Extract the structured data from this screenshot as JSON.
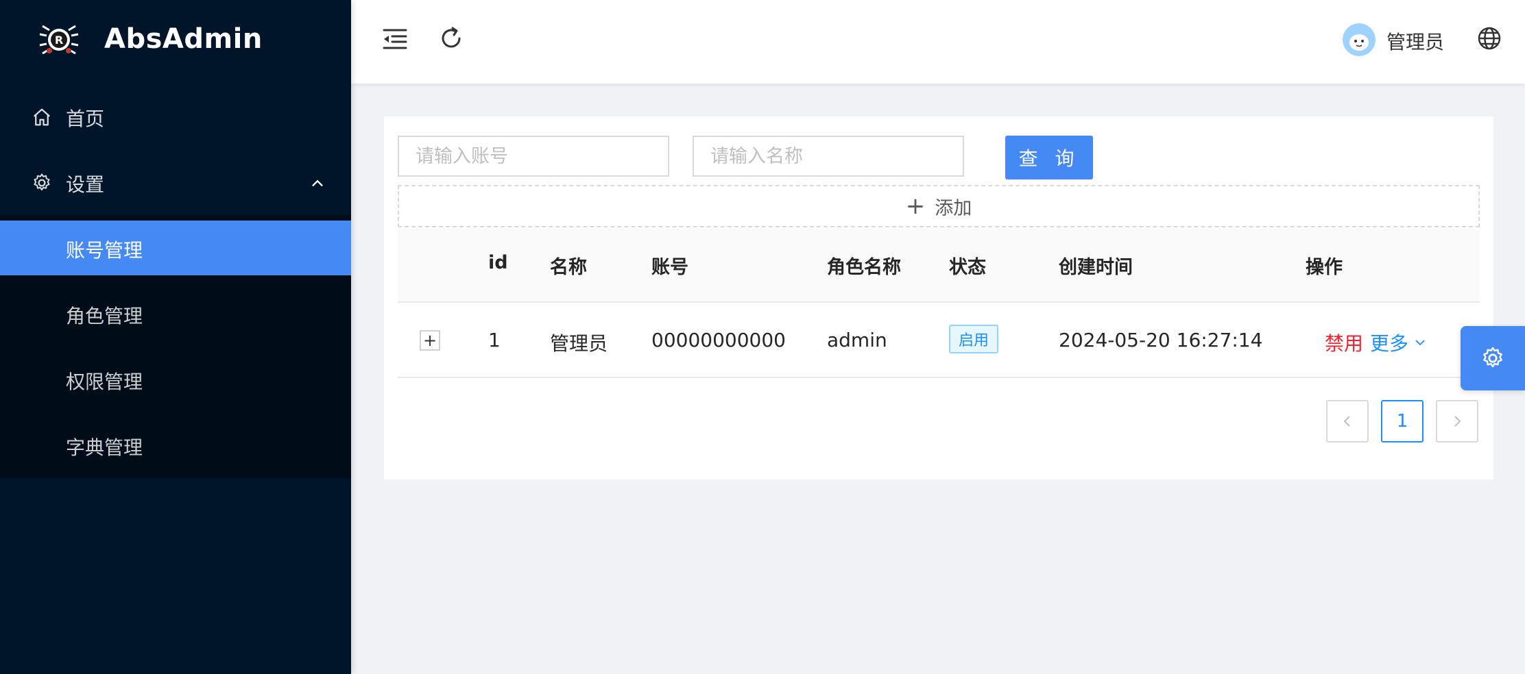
{
  "app": {
    "title": "AbsAdmin"
  },
  "sidebar": {
    "items": [
      {
        "label": "首页",
        "icon": "home-icon"
      },
      {
        "label": "设置",
        "icon": "gear-icon",
        "expanded": true
      }
    ],
    "submenu": [
      {
        "label": "账号管理",
        "active": true
      },
      {
        "label": "角色管理"
      },
      {
        "label": "权限管理"
      },
      {
        "label": "字典管理"
      }
    ]
  },
  "header": {
    "user_name": "管理员",
    "icons": [
      "menu-fold-icon",
      "reload-icon",
      "avatar",
      "globe-icon"
    ]
  },
  "search": {
    "account_placeholder": "请输入账号",
    "account_value": "",
    "name_placeholder": "请输入名称",
    "name_value": "",
    "query_label": "查 询"
  },
  "add": {
    "label": "添加"
  },
  "table": {
    "columns": [
      "id",
      "名称",
      "账号",
      "角色名称",
      "状态",
      "创建时间",
      "操作"
    ],
    "rows": [
      {
        "id": "1",
        "name": "管理员",
        "account": "00000000000",
        "role": "admin",
        "status": "启用",
        "created": "2024-05-20 16:27:14",
        "action_disable": "禁用",
        "action_more": "更多"
      }
    ]
  },
  "pagination": {
    "current": "1"
  },
  "colors": {
    "sidebar_bg": "#001529",
    "submenu_bg": "#000c17",
    "primary": "#4589f5",
    "danger": "#f5222d",
    "link": "#1890ff",
    "page_bg": "#f0f2f5"
  }
}
